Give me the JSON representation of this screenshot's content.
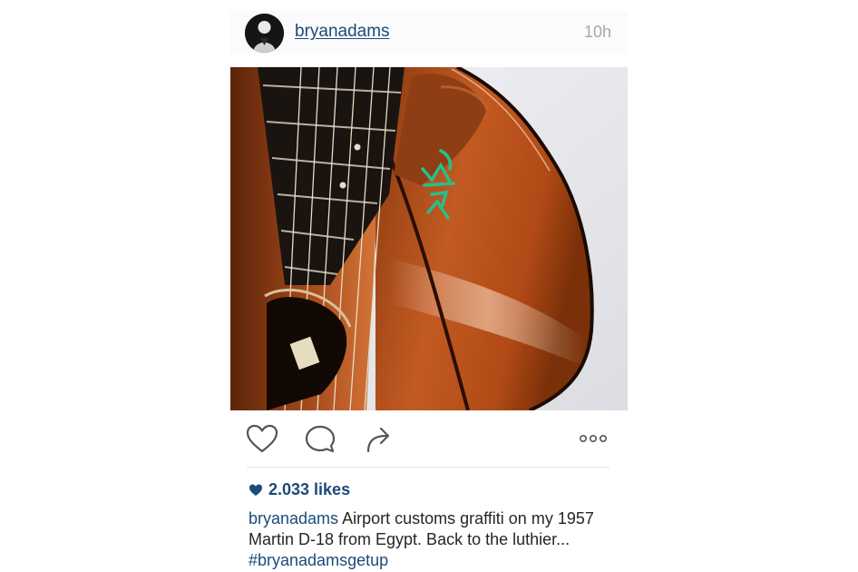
{
  "post": {
    "username": "bryanadams",
    "timestamp": "10h",
    "photo_graffiti": "WAXT",
    "likes": "2.033 likes",
    "caption": {
      "username": "bryanadams",
      "text": " Airport customs graffiti on my 1957 Martin D-18 from Egypt. Back to the luthier... ",
      "hashtag": "#bryanadamsgetup"
    }
  },
  "icons": {
    "like": "heart-outline-icon",
    "comment": "speech-bubble-icon",
    "share": "share-arrow-icon",
    "more": "ellipsis-icon",
    "likes": "heart-filled-icon"
  },
  "colors": {
    "link": "#1c4a7a",
    "text": "#262626",
    "timestamp": "#a8a8a8",
    "icon": "#555555",
    "graffiti": "#27c08a"
  }
}
